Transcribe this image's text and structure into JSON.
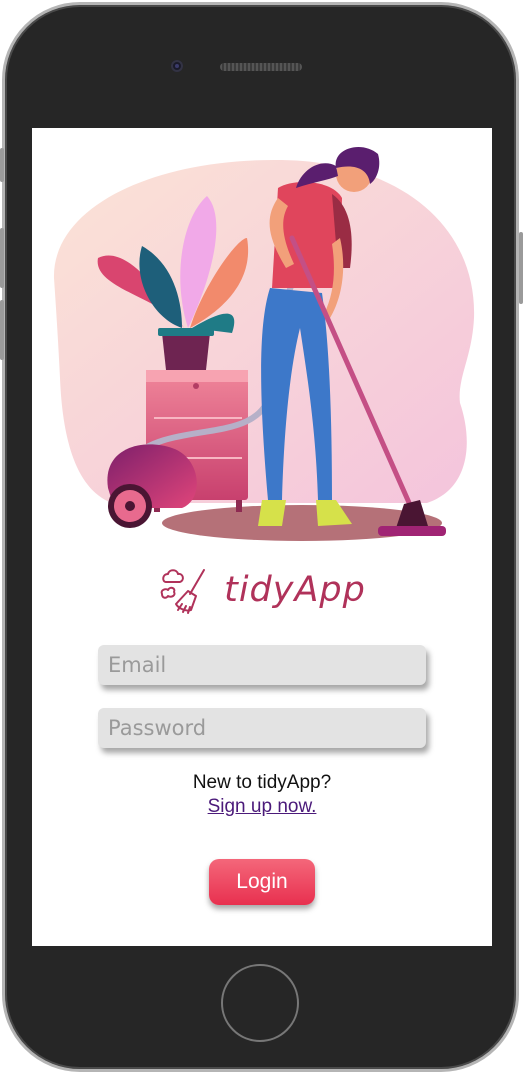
{
  "app": {
    "name": "tidyApp",
    "brand_color": "#b0325a",
    "accent_color": "#e8304f"
  },
  "hero": {
    "illustration": "woman-vacuuming-illustration"
  },
  "logo": {
    "text": "tidyApp",
    "icon": "broom-icon"
  },
  "form": {
    "email": {
      "placeholder": "Email",
      "value": ""
    },
    "password": {
      "placeholder": "Password",
      "value": ""
    },
    "signup_prompt": "New to tidyApp?",
    "signup_link": "Sign up now.",
    "login_label": "Login"
  }
}
